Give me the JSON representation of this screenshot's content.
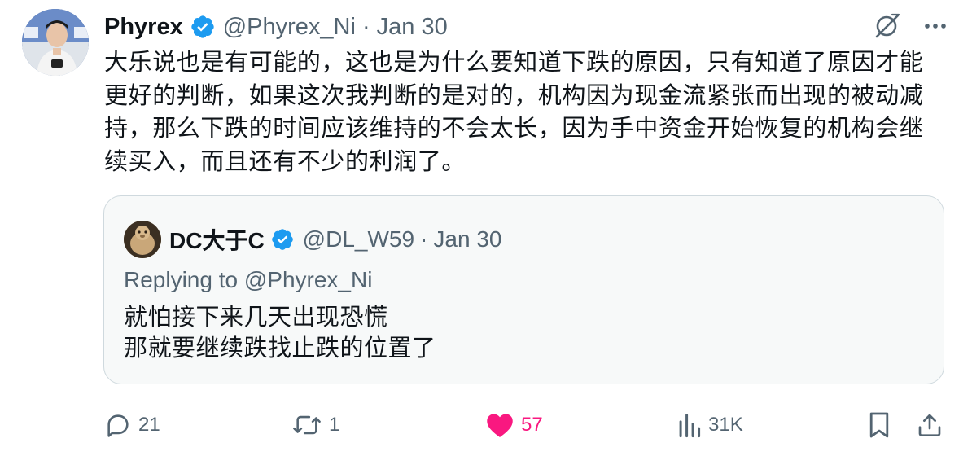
{
  "author": {
    "display_name": "Phyrex",
    "handle": "@Phyrex_Ni",
    "separator": "·",
    "date": "Jan 30"
  },
  "tweet": {
    "text_lines": [
      "大乐说也是有可能的，这也是为什么要知道下跌的原因，只有知道了原因才能",
      "更好的判断，如果这次我判断的是对的，机构因为现金流紧张而出现的被动减",
      "持，那么下跌的时间应该维持的不会太长，因为手中资金开始恢复的机构会继",
      "续买入，而且还有不少的利润了。"
    ]
  },
  "quote": {
    "display_name": "DC大于C",
    "handle": "@DL_W59",
    "separator": "·",
    "date": "Jan 30",
    "replying_to": "Replying to @Phyrex_Ni",
    "text_lines": [
      "就怕接下来几天出现恐慌",
      "那就要继续跌找止跌的位置了"
    ]
  },
  "actions": {
    "replies": "21",
    "reposts": "1",
    "likes": "57",
    "views": "31K"
  },
  "icons": {
    "top_right": [
      "grok-slash-icon",
      "more-icon"
    ],
    "action_bar": [
      "reply-icon",
      "repost-icon",
      "like-icon",
      "views-icon",
      "bookmark-icon",
      "share-icon"
    ]
  },
  "colors": {
    "text": "#0f1419",
    "secondary": "#536471",
    "verified": "#1d9bf0",
    "like": "#f91880",
    "quote_border": "#cfd9de",
    "quote_bg": "#f7f9f9"
  }
}
